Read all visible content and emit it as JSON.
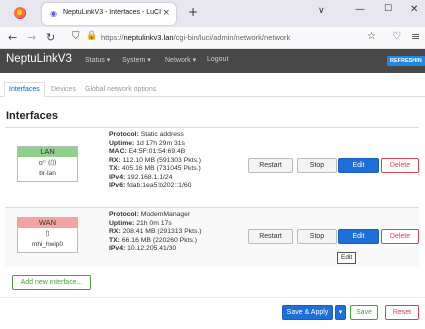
{
  "browser": {
    "tab_title": "NeptuLinkV3 - Interfaces - LuCI",
    "tab_close": "×",
    "new_tab": "+",
    "tab_list": "∨",
    "minimize": "—",
    "maximize": "☐",
    "close": "✕",
    "back": "←",
    "forward": "→",
    "reload": "↻",
    "url_scheme": "https://",
    "url_host": "neptulinkv3.lan",
    "url_path": "/cgi-bin/luci/admin/network/network"
  },
  "header": {
    "brand": "NeptuLinkV3",
    "menu": [
      {
        "label": "Status ▾"
      },
      {
        "label": "System ▾"
      },
      {
        "label": "Network ▾"
      },
      {
        "label": "Logout"
      }
    ],
    "refresh": "REFRESHIN"
  },
  "tabs": [
    {
      "label": "Interfaces",
      "active": true
    },
    {
      "label": "Devices",
      "active": false
    },
    {
      "label": "Global network options",
      "active": false
    }
  ],
  "section_title": "Interfaces",
  "interfaces": [
    {
      "name": "LAN",
      "color": "#8fd18a",
      "icon": "ɑ⁰ (⩇)",
      "device": "br-lan",
      "info": [
        {
          "k": "Protocol:",
          "v": "Static address"
        },
        {
          "k": "Uptime:",
          "v": "1d 17h 29m 31s"
        },
        {
          "k": "MAC:",
          "v": "E4:5F:01:54:69:4B"
        },
        {
          "k": "RX:",
          "v": "112.10 MB (591303 Pkts.)"
        },
        {
          "k": "TX:",
          "v": "405.16 MB (731045 Pkts.)"
        },
        {
          "k": "IPv4:",
          "v": "192.168.1.1/24"
        },
        {
          "k": "IPv6:",
          "v": "fdab:1ea5:b202::1/60"
        }
      ]
    },
    {
      "name": "WAN",
      "color": "#f4a3a3",
      "icon": "⩇",
      "device": "mhi_hwip0",
      "info": [
        {
          "k": "Protocol:",
          "v": "ModemManager"
        },
        {
          "k": "Uptime:",
          "v": "21h 0m 17s"
        },
        {
          "k": "RX:",
          "v": "208.41 MB (291313 Pkts.)"
        },
        {
          "k": "TX:",
          "v": "66.16 MB (220260 Pkts.)"
        },
        {
          "k": "IPv4:",
          "v": "10.12.205.41/30"
        }
      ]
    }
  ],
  "buttons": {
    "restart": "Restart",
    "stop": "Stop",
    "edit": "Edit",
    "delete": "Delete",
    "add": "Add new interface...",
    "save_apply": "Save & Apply",
    "dropdown": "▾",
    "save": "Save",
    "reset": "Reset"
  },
  "tooltip": "Edit"
}
